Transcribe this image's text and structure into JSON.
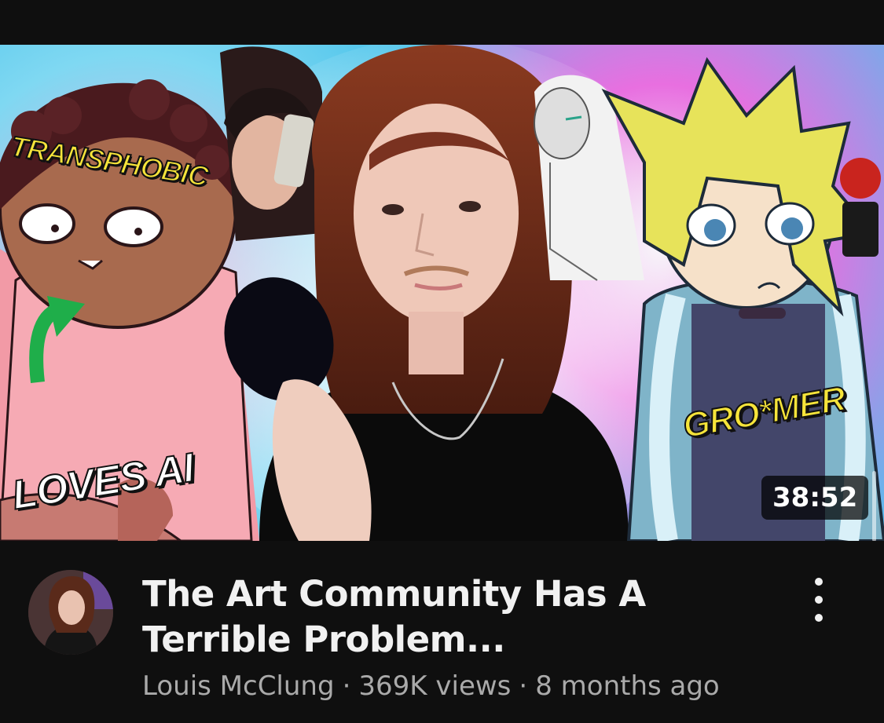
{
  "video": {
    "thumbnail": {
      "captions": {
        "transphobic": "TRANSPHOBIC",
        "loves_ai": "LOVES AI",
        "gromer": "GRO*MER"
      },
      "duration": "38:52"
    },
    "title": "The Art Community Has A Terrible Problem...",
    "channel": "Louis McClung",
    "views": "369K views",
    "age": "8 months ago",
    "separator": "·"
  },
  "icons": {
    "menu": "more-vertical-icon",
    "arrow": "green-arrow-icon"
  },
  "colors": {
    "background": "#0f0f0f",
    "title_text": "#f1f1f1",
    "meta_text": "#aaaaaa",
    "caption_yellow": "#f6e43a",
    "arrow_green": "#1fae4a"
  }
}
